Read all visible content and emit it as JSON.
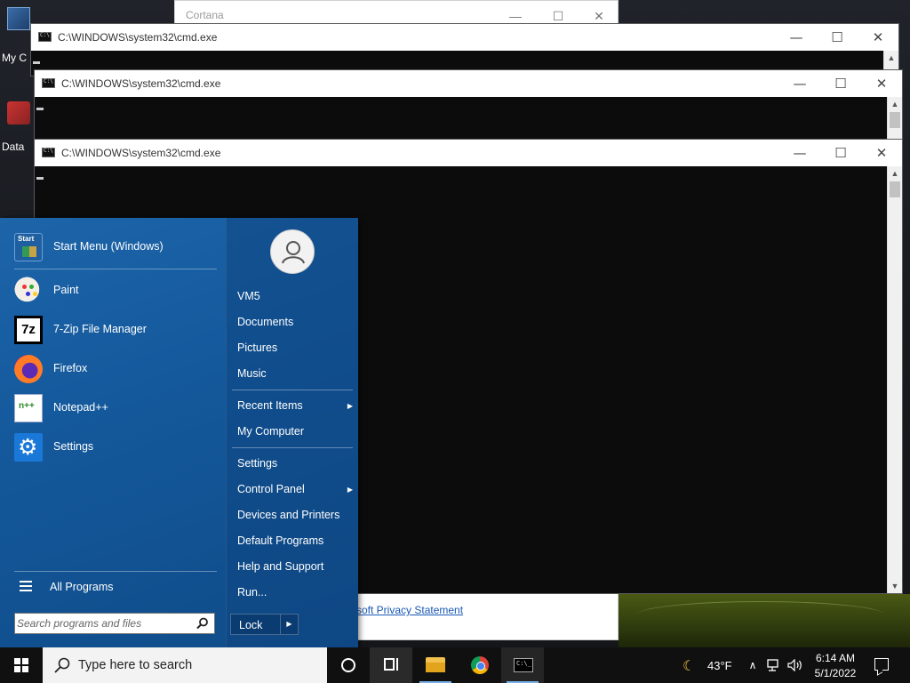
{
  "desktop": {
    "icons": [
      {
        "label": "My C"
      },
      {
        "label": "Data"
      }
    ]
  },
  "cortana": {
    "title": "Cortana",
    "privacy_link": "soft Privacy Statement"
  },
  "cmd_windows": [
    {
      "title": "C:\\WINDOWS\\system32\\cmd.exe"
    },
    {
      "title": "C:\\WINDOWS\\system32\\cmd.exe"
    },
    {
      "title": "C:\\WINDOWS\\system32\\cmd.exe"
    }
  ],
  "window_controls": {
    "minimize": "—",
    "maximize": "☐",
    "close": "✕"
  },
  "start_menu": {
    "programs": [
      {
        "label": "Start Menu (Windows)",
        "icon": "start-menu-icon"
      },
      {
        "label": "Paint",
        "icon": "paint-icon"
      },
      {
        "label": "7-Zip File Manager",
        "icon": "7zip-icon"
      },
      {
        "label": "Firefox",
        "icon": "firefox-icon"
      },
      {
        "label": "Notepad++",
        "icon": "notepad-plus-plus-icon"
      },
      {
        "label": "Settings",
        "icon": "settings-gear-icon"
      }
    ],
    "seven_zip_icon_text": "7z",
    "all_programs": "All Programs",
    "search_placeholder": "Search programs and files",
    "right": {
      "user": "VM5",
      "items": [
        {
          "label": "Documents"
        },
        {
          "label": "Pictures"
        },
        {
          "label": "Music"
        },
        {
          "label": "Recent Items",
          "arrow": "▶"
        },
        {
          "label": "My Computer"
        },
        {
          "label": "Settings"
        },
        {
          "label": "Control Panel",
          "arrow": "▶"
        },
        {
          "label": "Devices and Printers"
        },
        {
          "label": "Default Programs"
        },
        {
          "label": "Help and Support"
        },
        {
          "label": "Run..."
        }
      ],
      "lock": "Lock",
      "lock_arrow": "▶"
    }
  },
  "taskbar": {
    "search_text": "Type here to search",
    "weather": {
      "temp": "43°F",
      "icon": "moon-icon"
    },
    "tray": {
      "chevron": "∧"
    },
    "clock": {
      "time": "6:14 AM",
      "date": "5/1/2022"
    }
  },
  "colors": {
    "start_menu_bg": "#14599c",
    "taskbar_bg": "#101010",
    "link": "#1a58b6"
  }
}
